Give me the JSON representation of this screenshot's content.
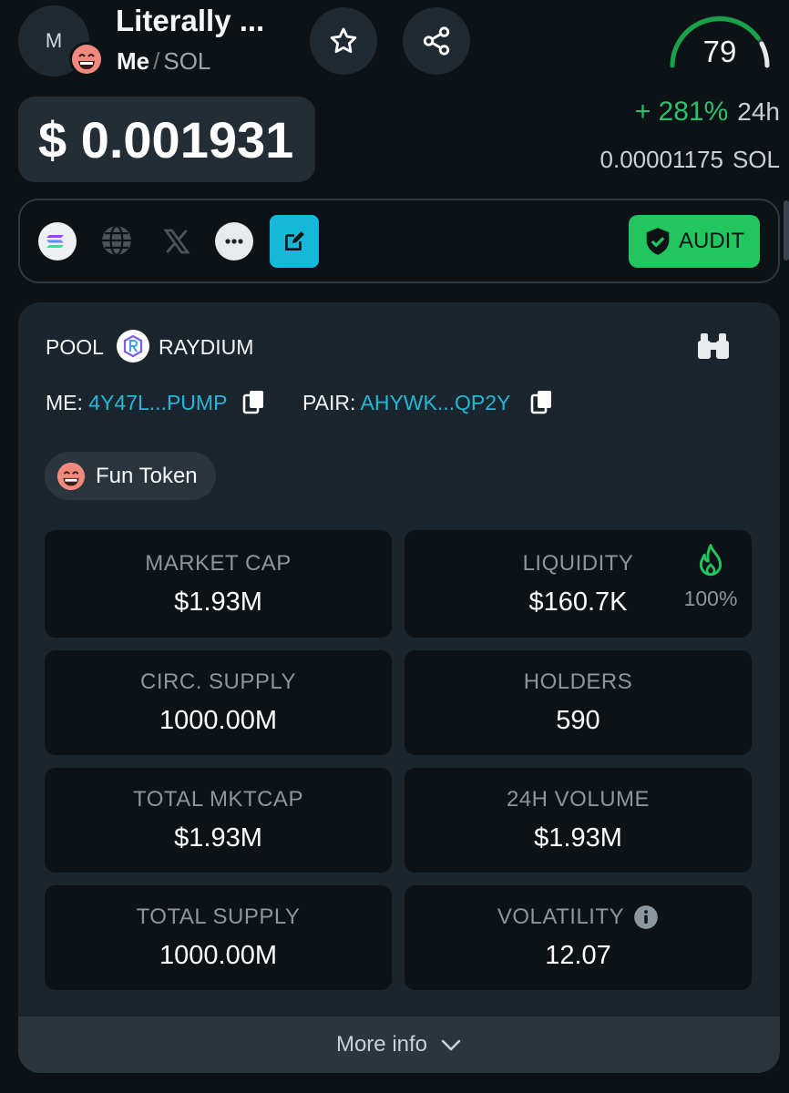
{
  "header": {
    "avatar_letter": "M",
    "token_name": "Literally ...",
    "symbol": "Me",
    "separator": "/",
    "quote": "SOL",
    "score": "79"
  },
  "price": {
    "usd": "$ 0.001931",
    "change_pct": "+ 281%",
    "change_period": "24h",
    "sol_value": "0.00001175",
    "sol_unit": "SOL"
  },
  "social": {
    "icons": [
      "solana-icon",
      "globe-icon",
      "x-icon",
      "more-icon",
      "edit-icon"
    ],
    "audit_label": "AUDIT"
  },
  "pool": {
    "label": "POOL",
    "dex": "RAYDIUM",
    "token_key": "ME:",
    "token_address": "4Y47L...PUMP",
    "pair_key": "PAIR:",
    "pair_address": "AHYWK...QP2Y",
    "tag": "Fun Token"
  },
  "stats": {
    "market_cap": {
      "label": "MARKET CAP",
      "value": "$1.93M"
    },
    "liquidity": {
      "label": "LIQUIDITY",
      "value": "$160.7K",
      "burn_pct": "100%"
    },
    "circ_supply": {
      "label": "CIRC. SUPPLY",
      "value": "1000.00M"
    },
    "holders": {
      "label": "HOLDERS",
      "value": "590"
    },
    "total_mktcap": {
      "label": "TOTAL MKTCAP",
      "value": "$1.93M"
    },
    "volume_24h": {
      "label": "24H VOLUME",
      "value": "$1.93M"
    },
    "total_supply": {
      "label": "TOTAL SUPPLY",
      "value": "1000.00M"
    },
    "volatility": {
      "label": "VOLATILITY",
      "value": "12.07"
    }
  },
  "footer": {
    "more_info": "More info"
  },
  "colors": {
    "background": "#0c1216",
    "card": "#1b252d",
    "positive": "#2bc16b",
    "link": "#22b8d8",
    "audit": "#22c55e"
  }
}
